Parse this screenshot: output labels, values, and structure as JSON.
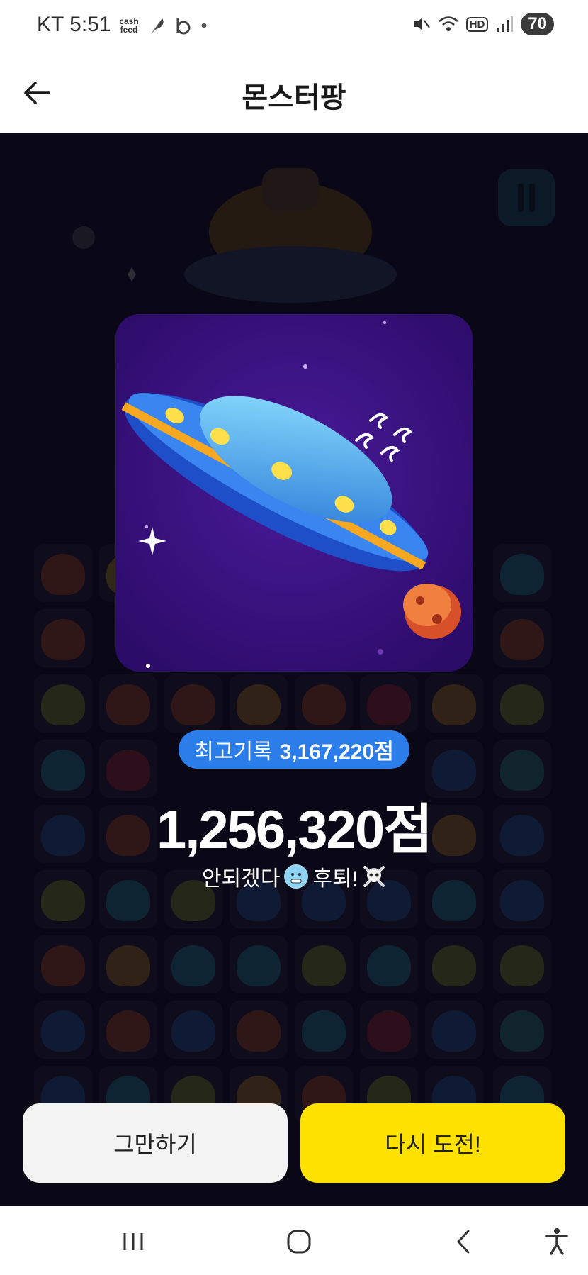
{
  "status_bar": {
    "carrier_time": "KT 5:51",
    "cashfeed_label": "cash feed",
    "hd_label": "HD",
    "battery": "70"
  },
  "app_bar": {
    "title": "몬스터팡"
  },
  "result": {
    "best_label": "최고기록",
    "best_value": "3,167,220점",
    "score": "1,256,320점",
    "message_part1": "안되겠다",
    "message_part2": "후퇴!",
    "emoji_face": "cold-face-emoji",
    "emoji_skull": "skull-crossbones-emoji"
  },
  "buttons": {
    "quit_label": "그만하기",
    "retry_label": "다시 도전!"
  },
  "colors": {
    "accent_blue": "#2b7de9",
    "retry_yellow": "#ffe100",
    "card_purple": "#3a1280"
  }
}
